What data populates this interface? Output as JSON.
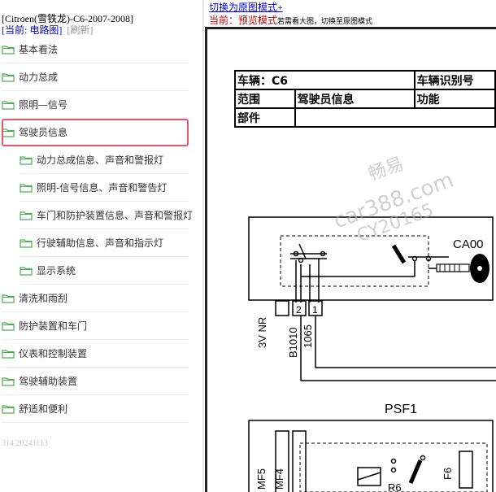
{
  "tree": {
    "vehicle": "[Citroen(雪铁龙)-C6-2007-2008]",
    "current_label": "[当前: 电路图]",
    "refresh": "[刷新]",
    "items": [
      {
        "label": "基本看法",
        "level": 0
      },
      {
        "label": "动力总成",
        "level": 0
      },
      {
        "label": "照明—信号",
        "level": 0
      },
      {
        "label": "驾驶员信息",
        "level": 0,
        "selected": true
      },
      {
        "label": "动力总成信息、声音和警报灯",
        "level": 1
      },
      {
        "label": "照明-信号信息、声音和警告灯",
        "level": 1
      },
      {
        "label": "车门和防护装置信息、声音和警报灯",
        "level": 1
      },
      {
        "label": "行驶辅助信息、声音和指示灯",
        "level": 1
      },
      {
        "label": "显示系统",
        "level": 1
      },
      {
        "label": "清洗和雨刮",
        "level": 0
      },
      {
        "label": "防护装置和车门",
        "level": 0
      },
      {
        "label": "仪表和控制装置",
        "level": 0
      },
      {
        "label": "驾驶辅助装置",
        "level": 0
      },
      {
        "label": "舒适和便利",
        "level": 0
      }
    ],
    "footer": "314.20241113"
  },
  "viewer": {
    "switch_link": "切换为原图模式+",
    "mode_label": "当前：",
    "mode_value": "预览模式",
    "mode_hint": "若需看大图，切换至原图模式"
  },
  "doc": {
    "row1": {
      "vehicle": "车辆：C6",
      "vin": "车辆识别号"
    },
    "row2": {
      "scope": "范围",
      "scope_value": "驾驶员信息",
      "function": "功能"
    },
    "row3": {
      "part": "部件"
    }
  },
  "diagram": {
    "connector_ca00": "CA00",
    "pin2": "2",
    "pin1": "1",
    "label_3v_nr": "3V NR",
    "wire_b1010": "B1010",
    "wire_1065": "1065",
    "psf1": "PSF1",
    "mf5": "MF5",
    "mf4": "MF4",
    "r6": "R6",
    "f6": "F6"
  },
  "watermark": {
    "line1": "畅易",
    "line2": "car388.com",
    "line3": "CY20165"
  },
  "colors": {
    "selection_border": "#e8566b",
    "link": "#0000ee",
    "mode_red": "#cc0000",
    "folder": "#4caf50"
  }
}
